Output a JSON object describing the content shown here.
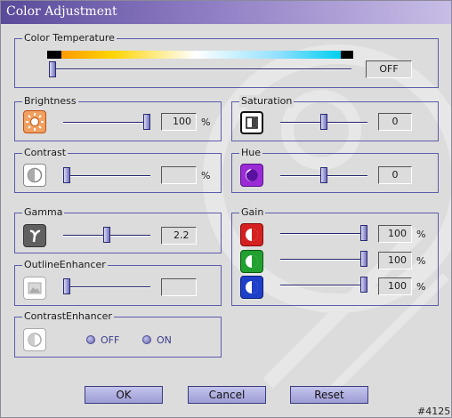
{
  "window": {
    "title": "Color Adjustment"
  },
  "color_temperature": {
    "label": "Color Temperature",
    "value": "OFF",
    "slider_level": 0.0
  },
  "brightness": {
    "label": "Brightness",
    "value": "100",
    "unit": "%",
    "slider_level": 1.0
  },
  "contrast": {
    "label": "Contrast",
    "value": "",
    "unit": "%",
    "slider_level": 0.0
  },
  "gamma": {
    "label": "Gamma",
    "value": "2.2",
    "slider_level": 0.5
  },
  "outline_enhancer": {
    "label": "OutlineEnhancer",
    "value": "",
    "slider_level": 0.0
  },
  "contrast_enhancer": {
    "label": "ContrastEnhancer",
    "off_label": "OFF",
    "on_label": "ON"
  },
  "saturation": {
    "label": "Saturation",
    "value": "0",
    "slider_level": 0.5
  },
  "hue": {
    "label": "Hue",
    "value": "0",
    "slider_level": 0.5
  },
  "gain": {
    "label": "Gain",
    "red": {
      "value": "100",
      "unit": "%",
      "slider_level": 1.0
    },
    "green": {
      "value": "100",
      "unit": "%",
      "slider_level": 1.0
    },
    "blue": {
      "value": "100",
      "unit": "%",
      "slider_level": 1.0
    }
  },
  "buttons": {
    "ok": "OK",
    "cancel": "Cancel",
    "reset": "Reset"
  },
  "code_label": "#4125",
  "colors": {
    "title_gradient_start": "#5a4a9a",
    "title_gradient_end": "#c8bde6",
    "group_border": "#5c5cab",
    "button_fill": "#b0b0e4",
    "brightness_icon": "#e8702a",
    "hue_icon": "#9a2bd6",
    "gain_red": "#d42020",
    "gain_green": "#22a030",
    "gain_blue": "#1e3fc8"
  },
  "icons": [
    "sun-icon",
    "contrast-icon",
    "gamma-icon",
    "outline-icon",
    "contrast-enhancer-icon",
    "saturation-icon",
    "hue-icon",
    "red-channel-icon",
    "green-channel-icon",
    "blue-channel-icon"
  ]
}
